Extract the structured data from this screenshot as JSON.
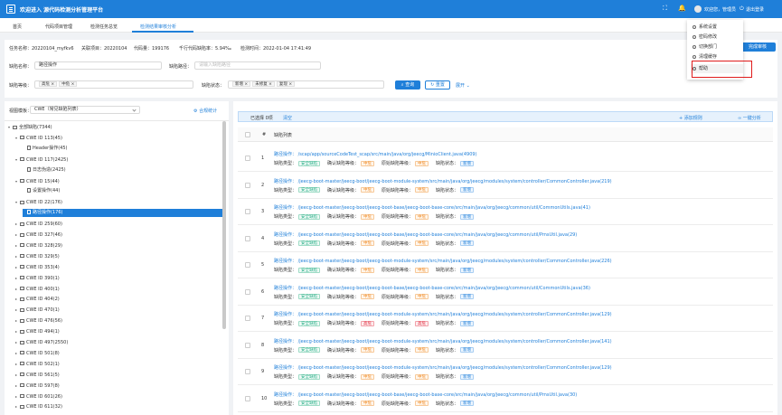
{
  "app": {
    "title": "欢迎进入 源代码检测分析管理平台",
    "user": "欢迎您，管理员",
    "logout": "退出登录"
  },
  "tabs": [
    {
      "label": "首页",
      "active": false
    },
    {
      "label": "代码项目管理",
      "active": false
    },
    {
      "label": "检测任务总览",
      "active": false
    },
    {
      "label": "检测结果审核分析",
      "active": true
    }
  ],
  "user_menu": [
    "系统设置",
    "密码修改",
    "切换部门",
    "清理缓存",
    "帮助"
  ],
  "complete_button": "完成审核",
  "task_info": [
    "任务名称：20220104_myfkv6",
    "关联项目：20220104",
    "代码量：199176",
    "千行代码缺陷率：5.94‰",
    "检测时间：2022-01-04 17:41:49"
  ],
  "filters": {
    "name_label": "缺陷名称：",
    "name_value": "路径操作",
    "path_label": "缺陷路径：",
    "path_placeholder": "请输入缺陷路径",
    "level_label": "缺陷等级：",
    "level_tags": [
      "高危",
      "中危"
    ],
    "status_label": "缺陷状态：",
    "status_tags": [
      "新增",
      "未修复",
      "复现"
    ],
    "query": "查询",
    "reset": "重置",
    "expand": "展开"
  },
  "tree": {
    "mode_label": "视图模板：",
    "mode_value": "CWE（常见缺陷列表）",
    "stats_label": "合规统计",
    "nodes": [
      {
        "label": "全部缺陷(7344)",
        "level": 0,
        "open": true,
        "type": "folder"
      },
      {
        "label": "CWE ID 113(45)",
        "level": 1,
        "open": true,
        "type": "folder"
      },
      {
        "label": "Header操作(45)",
        "level": 2,
        "type": "file"
      },
      {
        "label": "CWE ID 117(2425)",
        "level": 1,
        "open": true,
        "type": "folder"
      },
      {
        "label": "日志伪造(2425)",
        "level": 2,
        "type": "file"
      },
      {
        "label": "CWE ID 15(44)",
        "level": 1,
        "open": true,
        "type": "folder"
      },
      {
        "label": "设置操作(44)",
        "level": 2,
        "type": "file"
      },
      {
        "label": "CWE ID 22(176)",
        "level": 1,
        "open": true,
        "type": "folder"
      },
      {
        "label": "路径操作(176)",
        "level": 2,
        "type": "file",
        "selected": true
      },
      {
        "label": "CWE ID 259(60)",
        "level": 1,
        "type": "folder"
      },
      {
        "label": "CWE ID 327(46)",
        "level": 1,
        "type": "folder"
      },
      {
        "label": "CWE ID 328(29)",
        "level": 1,
        "type": "folder"
      },
      {
        "label": "CWE ID 329(5)",
        "level": 1,
        "type": "folder"
      },
      {
        "label": "CWE ID 353(4)",
        "level": 1,
        "type": "folder"
      },
      {
        "label": "CWE ID 390(1)",
        "level": 1,
        "type": "folder"
      },
      {
        "label": "CWE ID 400(1)",
        "level": 1,
        "type": "folder"
      },
      {
        "label": "CWE ID 404(2)",
        "level": 1,
        "type": "folder"
      },
      {
        "label": "CWE ID 470(1)",
        "level": 1,
        "type": "folder"
      },
      {
        "label": "CWE ID 476(56)",
        "level": 1,
        "type": "folder"
      },
      {
        "label": "CWE ID 494(1)",
        "level": 1,
        "type": "folder"
      },
      {
        "label": "CWE ID 497(2550)",
        "level": 1,
        "type": "folder"
      },
      {
        "label": "CWE ID 501(8)",
        "level": 1,
        "type": "folder"
      },
      {
        "label": "CWE ID 502(1)",
        "level": 1,
        "type": "folder"
      },
      {
        "label": "CWE ID 561(5)",
        "level": 1,
        "type": "folder"
      },
      {
        "label": "CWE ID 597(8)",
        "level": 1,
        "type": "folder"
      },
      {
        "label": "CWE ID 601(26)",
        "level": 1,
        "type": "folder"
      },
      {
        "label": "CWE ID 611(32)",
        "level": 1,
        "type": "folder"
      }
    ]
  },
  "list": {
    "selected": "已选择 0项",
    "clear": "清空",
    "add_rule": "添加规则",
    "one_click": "一键分析",
    "col_index": "#",
    "col_title": "缺陷列表",
    "labels": {
      "type": "缺陷类型：",
      "confirm": "确认缺陷等级：",
      "orig": "原始缺陷等级：",
      "status": "缺陷状态："
    },
    "rows": [
      {
        "n": "1",
        "name": "路径操作：",
        "path": "/scap/app/sourceCodeTest_scap/src/main/java/org/jeecg/MinioClient.java(4909)",
        "type": "安全缺陷",
        "confirm": "中危",
        "orig": "中危",
        "status": "新增"
      },
      {
        "n": "2",
        "name": "路径操作：",
        "path": "/jeecg-boot-master/jeecg-boot/jeecg-boot-module-system/src/main/java/org/jeecg/modules/system/controller/CommonController.java(219)",
        "type": "安全缺陷",
        "confirm": "中危",
        "orig": "中危",
        "status": "新增"
      },
      {
        "n": "3",
        "name": "路径操作：",
        "path": "/jeecg-boot-master/jeecg-boot/jeecg-boot-base/jeecg-boot-base-core/src/main/java/org/jeecg/common/util/CommonUtils.java(41)",
        "type": "安全缺陷",
        "confirm": "中危",
        "orig": "中危",
        "status": "新增"
      },
      {
        "n": "4",
        "name": "路径操作：",
        "path": "/jeecg-boot-master/jeecg-boot/jeecg-boot-base/jeecg-boot-base-core/src/main/java/org/jeecg/common/util/PmsUtil.java(29)",
        "type": "安全缺陷",
        "confirm": "中危",
        "orig": "中危",
        "status": "新增"
      },
      {
        "n": "5",
        "name": "路径操作：",
        "path": "/jeecg-boot-master/jeecg-boot/jeecg-boot-module-system/src/main/java/org/jeecg/modules/system/controller/CommonController.java(226)",
        "type": "安全缺陷",
        "confirm": "中危",
        "orig": "中危",
        "status": "新增"
      },
      {
        "n": "6",
        "name": "路径操作：",
        "path": "/jeecg-boot-master/jeecg-boot/jeecg-boot-base/jeecg-boot-base-core/src/main/java/org/jeecg/common/util/CommonUtils.java(36)",
        "type": "安全缺陷",
        "confirm": "中危",
        "orig": "中危",
        "status": "新增"
      },
      {
        "n": "7",
        "name": "路径操作：",
        "path": "/jeecg-boot-master/jeecg-boot/jeecg-boot-module-system/src/main/java/org/jeecg/modules/system/controller/CommonController.java(129)",
        "type": "安全缺陷",
        "confirm": "高危",
        "orig": "高危",
        "status": "新增"
      },
      {
        "n": "8",
        "name": "路径操作：",
        "path": "/jeecg-boot-master/jeecg-boot/jeecg-boot-module-system/src/main/java/org/jeecg/modules/system/controller/CommonController.java(141)",
        "type": "安全缺陷",
        "confirm": "中危",
        "orig": "中危",
        "status": "新增"
      },
      {
        "n": "9",
        "name": "路径操作：",
        "path": "/jeecg-boot-master/jeecg-boot/jeecg-boot-module-system/src/main/java/org/jeecg/modules/system/controller/CommonController.java(129)",
        "type": "安全缺陷",
        "confirm": "中危",
        "orig": "中危",
        "status": "新增"
      },
      {
        "n": "10",
        "name": "路径操作：",
        "path": "/jeecg-boot-master/jeecg-boot/jeecg-boot-base/jeecg-boot-base-core/src/main/java/org/jeecg/common/util/PmsUtil.java(30)",
        "type": "安全缺陷",
        "confirm": "中危",
        "orig": "中危",
        "status": "新增"
      }
    ]
  }
}
